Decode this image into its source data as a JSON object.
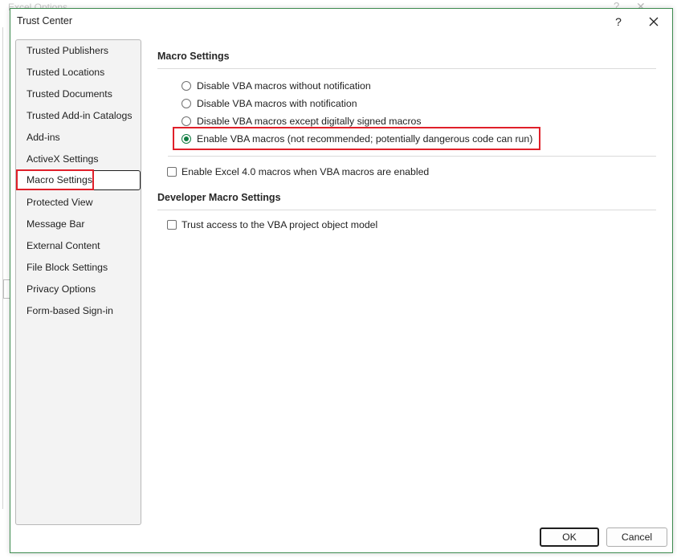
{
  "background_window": {
    "title": "Excel Options",
    "help_label": "?",
    "close_label": "✕"
  },
  "dialog": {
    "title": "Trust Center",
    "help_label": "?",
    "close_icon": "close-icon"
  },
  "sidebar": {
    "items": [
      {
        "label": "Trusted Publishers"
      },
      {
        "label": "Trusted Locations"
      },
      {
        "label": "Trusted Documents"
      },
      {
        "label": "Trusted Add-in Catalogs"
      },
      {
        "label": "Add-ins"
      },
      {
        "label": "ActiveX Settings"
      },
      {
        "label": "Macro Settings",
        "selected": true
      },
      {
        "label": "Protected View"
      },
      {
        "label": "Message Bar"
      },
      {
        "label": "External Content"
      },
      {
        "label": "File Block Settings"
      },
      {
        "label": "Privacy Options"
      },
      {
        "label": "Form-based Sign-in"
      }
    ]
  },
  "macro_settings": {
    "title": "Macro Settings",
    "options": [
      {
        "label": "Disable VBA macros without notification",
        "checked": false
      },
      {
        "label": "Disable VBA macros with notification",
        "checked": false
      },
      {
        "label": "Disable VBA macros except digitally signed macros",
        "checked": false
      },
      {
        "label": "Enable VBA macros (not recommended; potentially dangerous code can run)",
        "checked": true
      }
    ],
    "excel4_checkbox": {
      "label": "Enable Excel 4.0 macros when VBA macros are enabled",
      "checked": false
    }
  },
  "developer_macro_settings": {
    "title": "Developer Macro Settings",
    "vba_access_checkbox": {
      "label": "Trust access to the VBA project object model",
      "checked": false
    }
  },
  "footer": {
    "ok_label": "OK",
    "cancel_label": "Cancel"
  },
  "colors": {
    "accent": "#107c41",
    "highlight_box": "#e0202a",
    "dialog_border": "#3d8b4f"
  }
}
